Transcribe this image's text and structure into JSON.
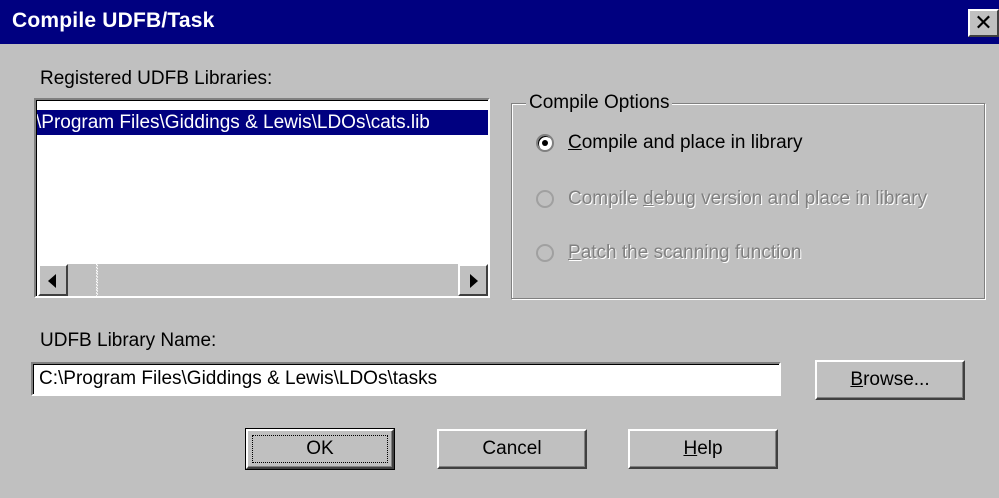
{
  "window": {
    "title": "Compile UDFB/Task",
    "close_glyph": "✕"
  },
  "libraries": {
    "label": "Registered UDFB Libraries:",
    "items": [
      "\\Program Files\\Giddings & Lewis\\LDOs\\cats.lib"
    ],
    "selected_index": 0
  },
  "compile_options": {
    "legend": "Compile Options",
    "options": [
      {
        "pre": "",
        "access": "C",
        "post": "ompile and place in library",
        "checked": true,
        "enabled": true
      },
      {
        "pre": "Compile ",
        "access": "d",
        "post": "ebug version and place in library",
        "checked": false,
        "enabled": false
      },
      {
        "pre": "",
        "access": "P",
        "post": "atch the scanning function",
        "checked": false,
        "enabled": false
      }
    ]
  },
  "library_name": {
    "label": "UDFB Library Name:",
    "value": "C:\\Program Files\\Giddings & Lewis\\LDOs\\tasks"
  },
  "buttons": {
    "browse": {
      "access": "B",
      "rest": "rowse..."
    },
    "ok": "OK",
    "cancel": "Cancel",
    "help": {
      "access": "H",
      "rest": "elp"
    }
  }
}
